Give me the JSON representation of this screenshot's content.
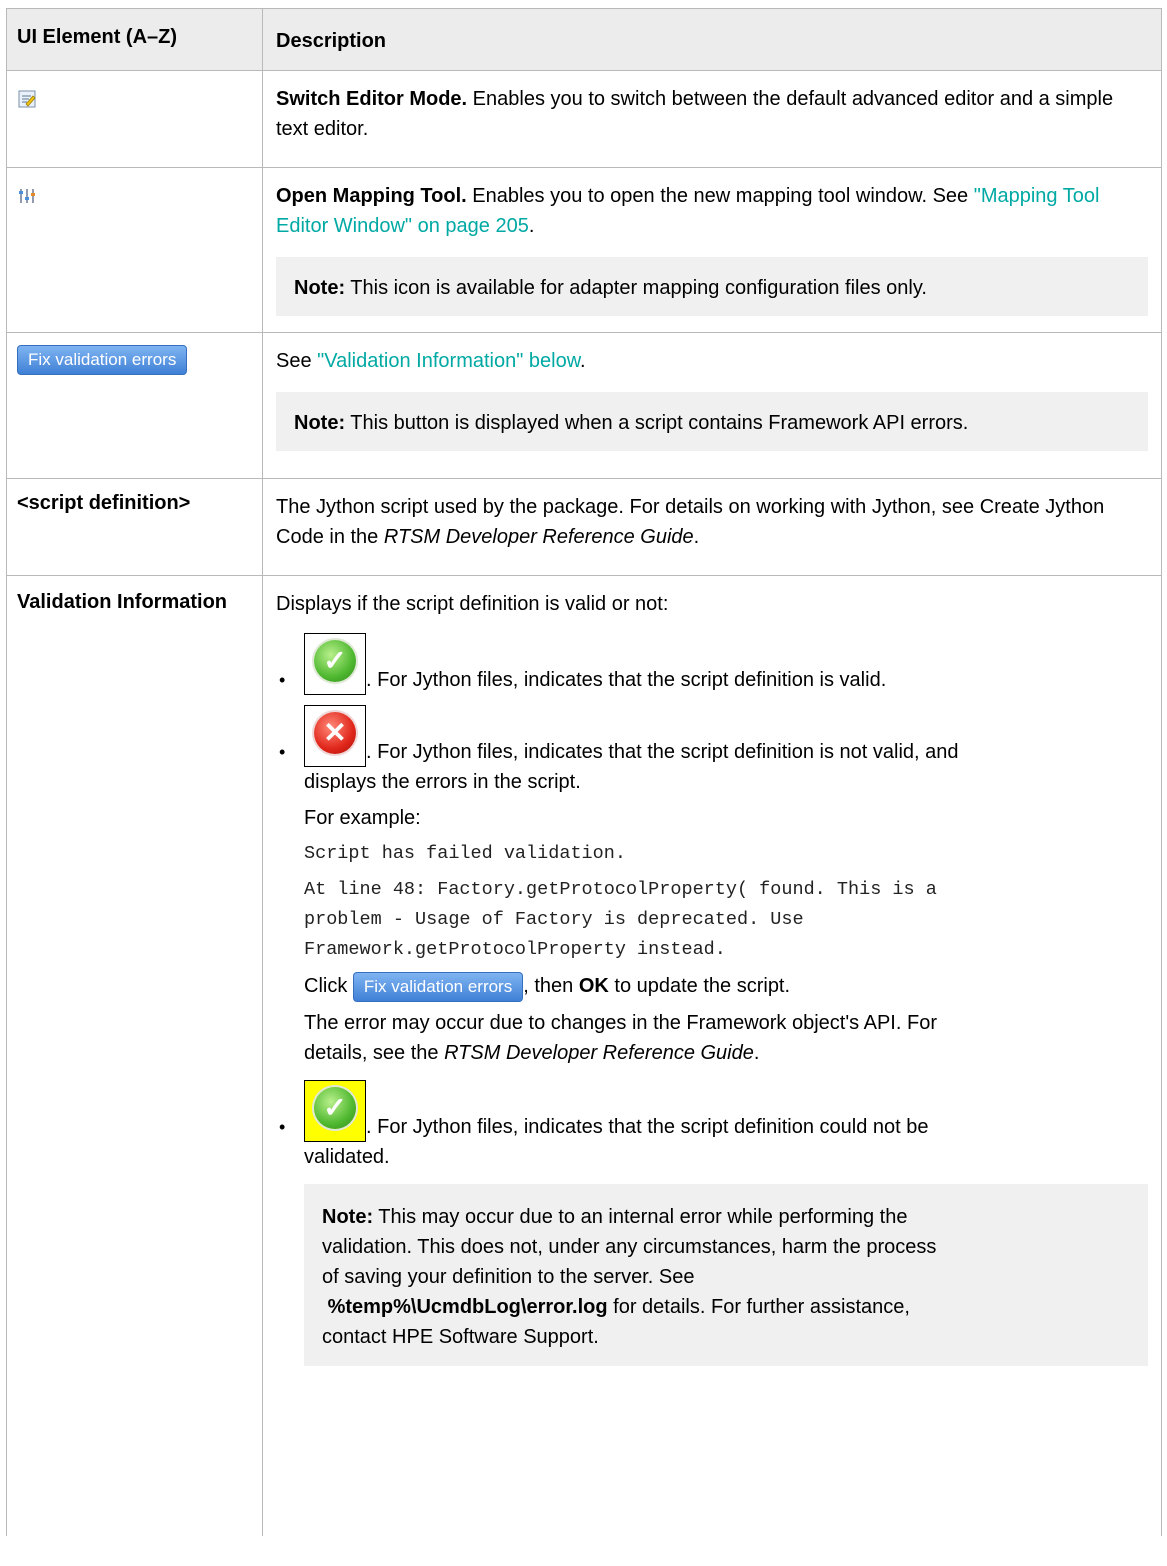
{
  "table": {
    "header": {
      "col1": "UI Element (A–Z)",
      "col2": "Description"
    },
    "rows": {
      "switch": {
        "title": "Switch Editor Mode.",
        "text": " Enables you to switch between the default advanced editor and a simple text editor."
      },
      "mapping": {
        "title": "Open Mapping Tool.",
        "text": " Enables you to open the new mapping tool window. See ",
        "link": "\"Mapping Tool Editor Window\" on page 205",
        "end": ".",
        "note_label": "Note:",
        "note_text": " This icon is available for adapter mapping configuration files only."
      },
      "fix": {
        "button_label": "Fix validation errors",
        "see": "See ",
        "link": "\"Validation Information\" below",
        "end": ".",
        "note_label": "Note:",
        "note_text": " This button is displayed when a script contains Framework API errors."
      },
      "script": {
        "element": "<script definition>",
        "text1": "The Jython script used by the package. For details on working with Jython, see Create Jython Code in the ",
        "italic": "RTSM Developer Reference Guide",
        "end": "."
      },
      "validation": {
        "element": "Validation Information",
        "intro": "Displays if the script definition is valid or not:",
        "b1": ". For Jython files, indicates that the script definition is valid.",
        "b2a": ". For Jython files, indicates that the script definition is not valid, and",
        "b2b": "displays the errors in the script.",
        "example_label": "For example:",
        "code1": "Script has failed validation.",
        "code2": "At line 48: Factory.getProtocolProperty( found. This is a",
        "code3": "problem - Usage of Factory is deprecated. Use",
        "code4": "Framework.getProtocolProperty instead.",
        "click": "Click ",
        "button_label": "Fix validation errors",
        "then": ", then ",
        "ok": "OK",
        "update": " to update the script.",
        "api1": "The error may occur due to changes in the Framework object's API. For",
        "api2": "details, see the ",
        "api_italic": "RTSM Developer Reference Guide",
        "api_end": ".",
        "b3a": ". For Jython files, indicates that the script definition could not be",
        "b3b": "validated.",
        "note_label": "Note:",
        "note1": " This may occur due to an internal error while performing the",
        "note2": "validation. This does not, under any circumstances, harm the process",
        "note3": "of saving your definition to the server. See",
        "note_path": "%temp%\\UcmdbLog\\error.log",
        "note4": " for details. For further assistance,",
        "note5": "contact HPE Software Support."
      }
    }
  },
  "icons": [
    "switch-editor-mode-icon",
    "open-mapping-tool-icon",
    "valid-check-icon",
    "invalid-x-icon",
    "could-not-validate-icon"
  ],
  "colors": {
    "link": "#00a9a3",
    "header_bg": "#ececec",
    "note_bg": "#f0f0f0",
    "warning_bg": "#ffff00"
  }
}
